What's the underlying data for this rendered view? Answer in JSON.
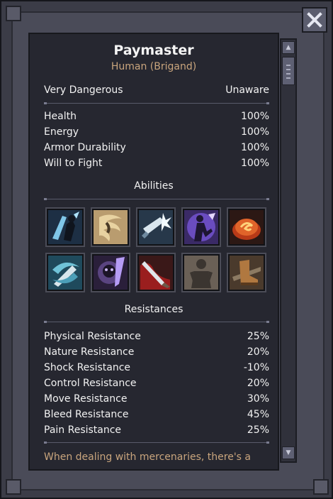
{
  "unit": {
    "name": "Paymaster",
    "race": "Human (Brigand)",
    "danger": "Very Dangerous",
    "awareness": "Unaware"
  },
  "stats": [
    {
      "label": "Health",
      "value": "100%"
    },
    {
      "label": "Energy",
      "value": "100%"
    },
    {
      "label": "Armor Durability",
      "value": "100%"
    },
    {
      "label": "Will to Fight",
      "value": "100%"
    }
  ],
  "abilities": {
    "heading": "Abilities",
    "icons": [
      "shadow-strike-icon",
      "dust-swirl-icon",
      "blade-flash-icon",
      "arcane-figure-icon",
      "fire-orb-icon",
      "spinning-blade-icon",
      "phantom-skull-icon",
      "bleeding-blade-icon",
      "brute-figure-icon",
      "boot-kick-icon"
    ]
  },
  "resistances": {
    "heading": "Resistances",
    "items": [
      {
        "label": "Physical Resistance",
        "value": "25%"
      },
      {
        "label": "Nature Resistance",
        "value": "20%"
      },
      {
        "label": "Shock Resistance",
        "value": "-10%"
      },
      {
        "label": "Control Resistance",
        "value": "20%"
      },
      {
        "label": "Move Resistance",
        "value": "30%"
      },
      {
        "label": "Bleed Resistance",
        "value": "45%"
      },
      {
        "label": "Pain Resistance",
        "value": "25%"
      }
    ]
  },
  "flavor_text": "When dealing with mercenaries, there's a",
  "colors": {
    "accent_text": "#c9a57d",
    "panel_bg": "#262730",
    "frame": "#4a4b58"
  }
}
